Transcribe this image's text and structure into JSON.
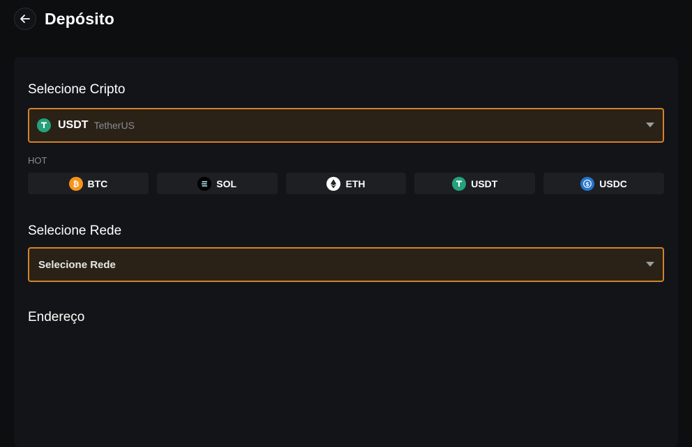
{
  "header": {
    "title": "Depósito"
  },
  "crypto": {
    "section_title": "Selecione Cripto",
    "selected": {
      "symbol": "USDT",
      "name": "TetherUS",
      "icon": "tether-icon",
      "color": "#26a17b"
    },
    "hot_label": "HOT",
    "hot_coins": [
      {
        "label": "BTC",
        "icon": "bitcoin-icon",
        "color": "#f7931a"
      },
      {
        "label": "SOL",
        "icon": "solana-icon",
        "color": "#000000"
      },
      {
        "label": "ETH",
        "icon": "ethereum-icon",
        "color": "#ffffff"
      },
      {
        "label": "USDT",
        "icon": "tether-icon",
        "color": "#26a17b"
      },
      {
        "label": "USDC",
        "icon": "usdc-icon",
        "color": "#2775ca"
      }
    ]
  },
  "network": {
    "section_title": "Selecione Rede",
    "placeholder": "Selecione Rede"
  },
  "address": {
    "section_title": "Endereço"
  },
  "colors": {
    "accent": "#d4822a",
    "background": "#0d0e10",
    "panel": "#131417"
  }
}
